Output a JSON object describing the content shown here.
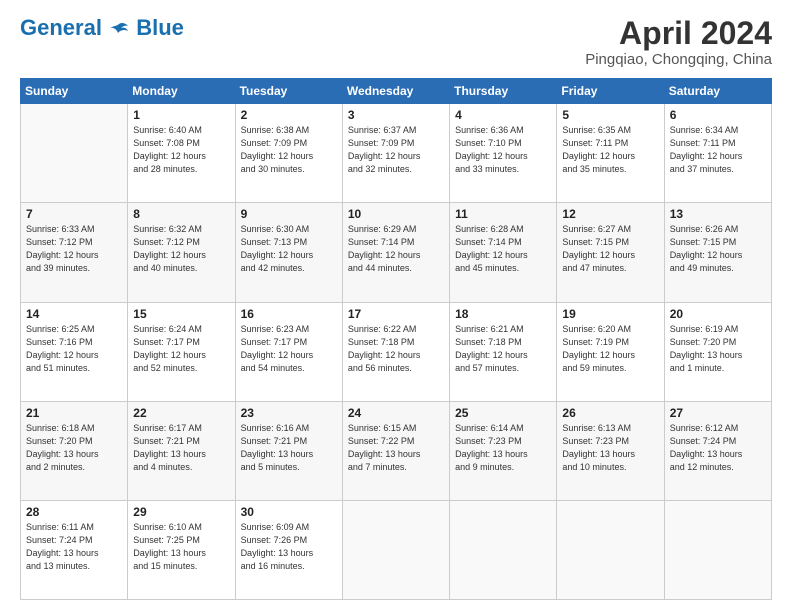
{
  "header": {
    "logo_general": "General",
    "logo_blue": "Blue",
    "month_title": "April 2024",
    "location": "Pingqiao, Chongqing, China"
  },
  "weekdays": [
    "Sunday",
    "Monday",
    "Tuesday",
    "Wednesday",
    "Thursday",
    "Friday",
    "Saturday"
  ],
  "weeks": [
    [
      {
        "day": "",
        "info": ""
      },
      {
        "day": "1",
        "info": "Sunrise: 6:40 AM\nSunset: 7:08 PM\nDaylight: 12 hours\nand 28 minutes."
      },
      {
        "day": "2",
        "info": "Sunrise: 6:38 AM\nSunset: 7:09 PM\nDaylight: 12 hours\nand 30 minutes."
      },
      {
        "day": "3",
        "info": "Sunrise: 6:37 AM\nSunset: 7:09 PM\nDaylight: 12 hours\nand 32 minutes."
      },
      {
        "day": "4",
        "info": "Sunrise: 6:36 AM\nSunset: 7:10 PM\nDaylight: 12 hours\nand 33 minutes."
      },
      {
        "day": "5",
        "info": "Sunrise: 6:35 AM\nSunset: 7:11 PM\nDaylight: 12 hours\nand 35 minutes."
      },
      {
        "day": "6",
        "info": "Sunrise: 6:34 AM\nSunset: 7:11 PM\nDaylight: 12 hours\nand 37 minutes."
      }
    ],
    [
      {
        "day": "7",
        "info": "Sunrise: 6:33 AM\nSunset: 7:12 PM\nDaylight: 12 hours\nand 39 minutes."
      },
      {
        "day": "8",
        "info": "Sunrise: 6:32 AM\nSunset: 7:12 PM\nDaylight: 12 hours\nand 40 minutes."
      },
      {
        "day": "9",
        "info": "Sunrise: 6:30 AM\nSunset: 7:13 PM\nDaylight: 12 hours\nand 42 minutes."
      },
      {
        "day": "10",
        "info": "Sunrise: 6:29 AM\nSunset: 7:14 PM\nDaylight: 12 hours\nand 44 minutes."
      },
      {
        "day": "11",
        "info": "Sunrise: 6:28 AM\nSunset: 7:14 PM\nDaylight: 12 hours\nand 45 minutes."
      },
      {
        "day": "12",
        "info": "Sunrise: 6:27 AM\nSunset: 7:15 PM\nDaylight: 12 hours\nand 47 minutes."
      },
      {
        "day": "13",
        "info": "Sunrise: 6:26 AM\nSunset: 7:15 PM\nDaylight: 12 hours\nand 49 minutes."
      }
    ],
    [
      {
        "day": "14",
        "info": "Sunrise: 6:25 AM\nSunset: 7:16 PM\nDaylight: 12 hours\nand 51 minutes."
      },
      {
        "day": "15",
        "info": "Sunrise: 6:24 AM\nSunset: 7:17 PM\nDaylight: 12 hours\nand 52 minutes."
      },
      {
        "day": "16",
        "info": "Sunrise: 6:23 AM\nSunset: 7:17 PM\nDaylight: 12 hours\nand 54 minutes."
      },
      {
        "day": "17",
        "info": "Sunrise: 6:22 AM\nSunset: 7:18 PM\nDaylight: 12 hours\nand 56 minutes."
      },
      {
        "day": "18",
        "info": "Sunrise: 6:21 AM\nSunset: 7:18 PM\nDaylight: 12 hours\nand 57 minutes."
      },
      {
        "day": "19",
        "info": "Sunrise: 6:20 AM\nSunset: 7:19 PM\nDaylight: 12 hours\nand 59 minutes."
      },
      {
        "day": "20",
        "info": "Sunrise: 6:19 AM\nSunset: 7:20 PM\nDaylight: 13 hours\nand 1 minute."
      }
    ],
    [
      {
        "day": "21",
        "info": "Sunrise: 6:18 AM\nSunset: 7:20 PM\nDaylight: 13 hours\nand 2 minutes."
      },
      {
        "day": "22",
        "info": "Sunrise: 6:17 AM\nSunset: 7:21 PM\nDaylight: 13 hours\nand 4 minutes."
      },
      {
        "day": "23",
        "info": "Sunrise: 6:16 AM\nSunset: 7:21 PM\nDaylight: 13 hours\nand 5 minutes."
      },
      {
        "day": "24",
        "info": "Sunrise: 6:15 AM\nSunset: 7:22 PM\nDaylight: 13 hours\nand 7 minutes."
      },
      {
        "day": "25",
        "info": "Sunrise: 6:14 AM\nSunset: 7:23 PM\nDaylight: 13 hours\nand 9 minutes."
      },
      {
        "day": "26",
        "info": "Sunrise: 6:13 AM\nSunset: 7:23 PM\nDaylight: 13 hours\nand 10 minutes."
      },
      {
        "day": "27",
        "info": "Sunrise: 6:12 AM\nSunset: 7:24 PM\nDaylight: 13 hours\nand 12 minutes."
      }
    ],
    [
      {
        "day": "28",
        "info": "Sunrise: 6:11 AM\nSunset: 7:24 PM\nDaylight: 13 hours\nand 13 minutes."
      },
      {
        "day": "29",
        "info": "Sunrise: 6:10 AM\nSunset: 7:25 PM\nDaylight: 13 hours\nand 15 minutes."
      },
      {
        "day": "30",
        "info": "Sunrise: 6:09 AM\nSunset: 7:26 PM\nDaylight: 13 hours\nand 16 minutes."
      },
      {
        "day": "",
        "info": ""
      },
      {
        "day": "",
        "info": ""
      },
      {
        "day": "",
        "info": ""
      },
      {
        "day": "",
        "info": ""
      }
    ]
  ]
}
